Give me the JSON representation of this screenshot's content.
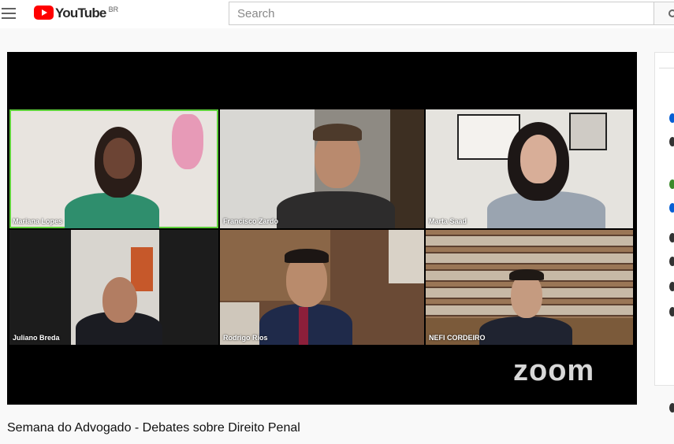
{
  "header": {
    "logo_text": "YouTube",
    "country_code": "BR",
    "search_placeholder": "Search"
  },
  "video": {
    "title": "Semana do Advogado - Debates sobre Direito Penal",
    "watermark": "zoom",
    "participants": [
      {
        "name": "Mariana Lopes",
        "active": true
      },
      {
        "name": "Francisco Zardo",
        "active": false
      },
      {
        "name": "Marta Saad",
        "active": false
      },
      {
        "name": "Juliano Breda",
        "active": false
      },
      {
        "name": "Rodrigo  Rios",
        "active": false
      },
      {
        "name": "NEFI CORDEIRO",
        "active": false
      }
    ]
  },
  "colors": {
    "brand_red": "#ff0000",
    "active_speaker": "#5fd13b",
    "accent_blue": "#065fd4"
  }
}
